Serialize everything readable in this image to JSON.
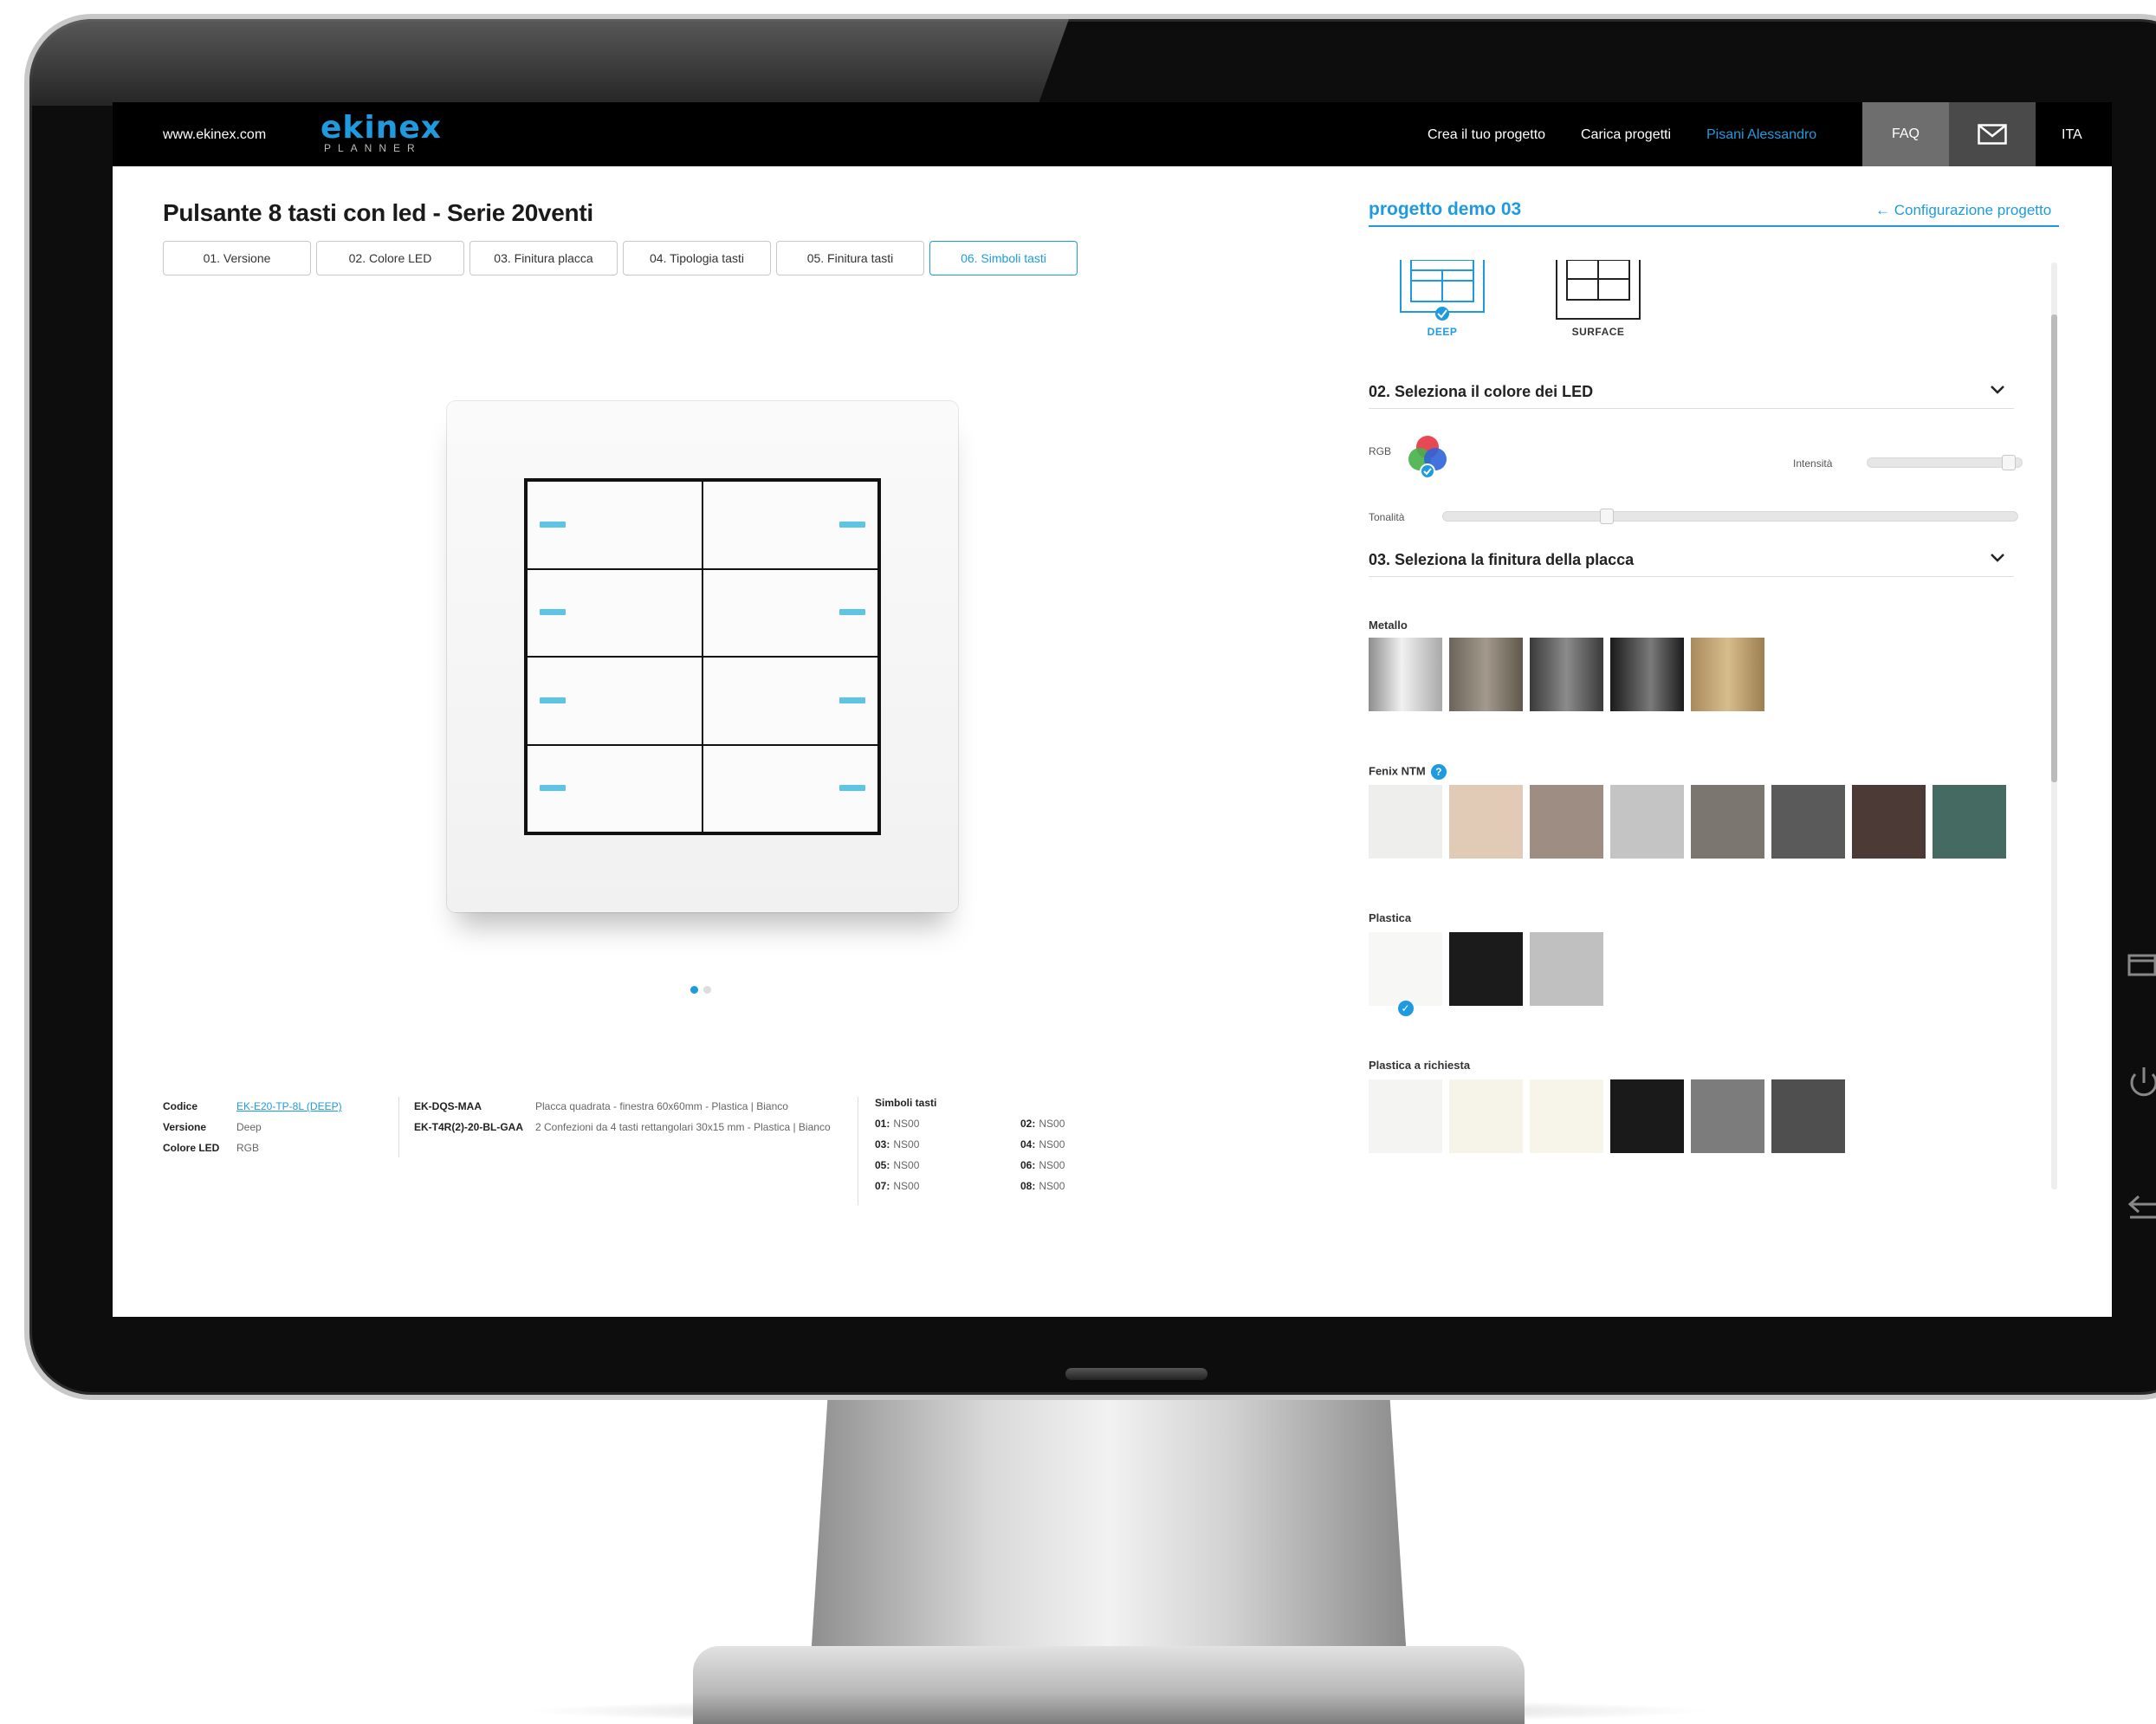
{
  "topbar": {
    "site_link": "www.ekinex.com",
    "logo_word": "ekinex",
    "logo_sub": "PLANNER",
    "nav": {
      "create_project": "Crea il tuo progetto",
      "load_projects": "Carica progetti",
      "user_name": "Pisani Alessandro",
      "faq": "FAQ",
      "language": "ITA"
    }
  },
  "product": {
    "title": "Pulsante 8 tasti con led - Serie 20venti",
    "steps": [
      {
        "label": "01. Versione"
      },
      {
        "label": "02. Colore LED"
      },
      {
        "label": "03. Finitura placca"
      },
      {
        "label": "04. Tipologia tasti"
      },
      {
        "label": "05. Finitura tasti"
      },
      {
        "label": "06. Simboli tasti"
      }
    ],
    "active_step": 6,
    "led_color": "#5ec4e6",
    "carousel_pages": 2,
    "carousel_current": 1
  },
  "summary": {
    "codice_label": "Codice",
    "codice_value": "EK-E20-TP-8L (DEEP)",
    "versione_label": "Versione",
    "versione_value": "Deep",
    "colore_label": "Colore LED",
    "colore_value": "RGB",
    "components": [
      {
        "code": "EK-DQS-MAA",
        "desc": "Placca quadrata - finestra 60x60mm - Plastica | Bianco"
      },
      {
        "code": "EK-T4R(2)-20-BL-GAA",
        "desc": "2 Confezioni da 4 tasti rettangolari 30x15 mm - Plastica | Bianco"
      }
    ],
    "symbols_title": "Simboli tasti",
    "symbols": [
      {
        "key": "01:",
        "value": "NS00"
      },
      {
        "key": "02:",
        "value": "NS00"
      },
      {
        "key": "03:",
        "value": "NS00"
      },
      {
        "key": "04:",
        "value": "NS00"
      },
      {
        "key": "05:",
        "value": "NS00"
      },
      {
        "key": "06:",
        "value": "NS00"
      },
      {
        "key": "07:",
        "value": "NS00"
      },
      {
        "key": "08:",
        "value": "NS00"
      }
    ]
  },
  "panel": {
    "project_name": "progetto demo 03",
    "config_link": "← Configurazione progetto",
    "versions": [
      {
        "label": "DEEP",
        "selected": true
      },
      {
        "label": "SURFACE",
        "selected": false
      }
    ],
    "led_section": {
      "title": "02. Seleziona il colore dei LED",
      "rgb_label": "RGB",
      "intensity_label": "Intensità",
      "intensity_value": 0.95,
      "hue_label": "Tonalità",
      "hue_value": 0.28
    },
    "finish_section": {
      "title": "03. Seleziona la finitura della placca",
      "groups": [
        {
          "label": "Metallo",
          "info": false,
          "swatches": [
            {
              "color": "linear-gradient(90deg,#8d8d8d,#f1f1f1 45%,#a9a9a9)",
              "selected": false
            },
            {
              "color": "linear-gradient(90deg,#6c6459,#a39a8d 50%,#5f574b)",
              "selected": false
            },
            {
              "color": "linear-gradient(90deg,#3a3a3a,#8b8b8b 50%,#3a3a3a)",
              "selected": false
            },
            {
              "color": "linear-gradient(90deg,#1b1b1b,#7a7a7a 55%,#1c1c1c)",
              "selected": false
            },
            {
              "color": "linear-gradient(90deg,#a88a5c,#d8bd8c 50%,#9c7e50)",
              "selected": false
            }
          ]
        },
        {
          "label": "Fenix NTM",
          "info": true,
          "info_symbol": "?",
          "swatches": [
            {
              "color": "#eeeeec",
              "selected": false
            },
            {
              "color": "#e1cbb6",
              "selected": false
            },
            {
              "color": "#9e8d83",
              "selected": false
            },
            {
              "color": "#c4c4c4",
              "selected": false
            },
            {
              "color": "#7b7670",
              "selected": false
            },
            {
              "color": "#5a5a5a",
              "selected": false
            },
            {
              "color": "#4b3a35",
              "selected": false
            },
            {
              "color": "#456a62",
              "selected": false
            }
          ]
        },
        {
          "label": "Plastica",
          "info": false,
          "swatches": [
            {
              "color": "#f7f7f6",
              "selected": true
            },
            {
              "color": "#1b1b1b",
              "selected": false
            },
            {
              "color": "#c0c0c0",
              "selected": false
            }
          ]
        },
        {
          "label": "Plastica a richiesta",
          "info": false,
          "swatches": [
            {
              "color": "#f4f4f2",
              "selected": false
            },
            {
              "color": "#f6f4e8",
              "selected": false
            },
            {
              "color": "#f7f5ea",
              "selected": false
            },
            {
              "color": "#1a1a1a",
              "selected": false
            },
            {
              "color": "#7c7c7c",
              "selected": false
            },
            {
              "color": "#4f4f4f",
              "selected": false
            }
          ]
        }
      ]
    }
  },
  "colors": {
    "accent": "#1e9be0",
    "topbar": "#000000",
    "faq_bg": "#6e6e6e",
    "mail_bg": "#4a4a4a"
  }
}
